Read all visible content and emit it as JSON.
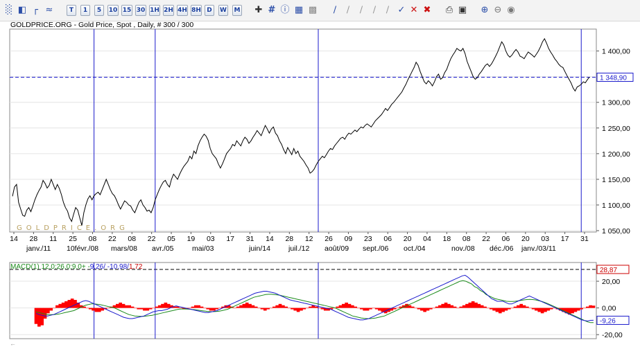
{
  "toolbar": {
    "period_buttons": [
      "T",
      "1",
      "5",
      "10",
      "15",
      "30",
      "1H",
      "2H",
      "4H",
      "8H",
      "D",
      "W",
      "M"
    ]
  },
  "chart_data": [
    {
      "type": "line",
      "title": "GOLDPRICE.ORG - Gold Price, Spot , Daily, # 300 / 300",
      "watermark": "GOLDPRICE.ORG",
      "ylim": [
        1050,
        1440
      ],
      "y_ticks": [
        "1 050,00",
        "1 100,00",
        "1 150,00",
        "1 200,00",
        "1 250,00",
        "1 300,00",
        "1 350,00",
        "1 400,00"
      ],
      "y_tick_values": [
        1050,
        1100,
        1150,
        1200,
        1250,
        1300,
        1350,
        1400
      ],
      "x_day_labels": [
        "14",
        "28",
        "11",
        "25",
        "08",
        "22",
        "08",
        "22",
        "05",
        "19",
        "03",
        "17",
        "31",
        "14",
        "28",
        "12",
        "26",
        "09",
        "23",
        "06",
        "20",
        "04",
        "18",
        "08",
        "22",
        "06",
        "20",
        "03",
        "17",
        "31"
      ],
      "x_month_labels": [
        "janv./11",
        "10févr./08",
        "mars/08",
        "avr./05",
        "mai/03",
        "juin/14",
        "juil./12",
        "août/09",
        "sept./06",
        "oct./04",
        "nov./08",
        "déc./06",
        "janv./03/11"
      ],
      "last_value": 1348.9,
      "last_value_label": "1 348,90",
      "line_color": "#000000",
      "hline_color": "#1a1acc",
      "vline_color": "#1a1acc",
      "series": [
        {
          "values": [
            1117,
            1135,
            1140,
            1105,
            1092,
            1080,
            1078,
            1090,
            1095,
            1087,
            1098,
            1110,
            1120,
            1128,
            1135,
            1148,
            1142,
            1133,
            1138,
            1150,
            1140,
            1130,
            1140,
            1132,
            1120,
            1105,
            1095,
            1088,
            1075,
            1068,
            1082,
            1095,
            1090,
            1075,
            1060,
            1085,
            1100,
            1112,
            1118,
            1110,
            1118,
            1122,
            1125,
            1120,
            1130,
            1140,
            1150,
            1140,
            1130,
            1122,
            1118,
            1110,
            1100,
            1092,
            1100,
            1108,
            1105,
            1100,
            1098,
            1090,
            1085,
            1095,
            1105,
            1110,
            1100,
            1095,
            1088,
            1090,
            1085,
            1095,
            1110,
            1120,
            1130,
            1138,
            1145,
            1148,
            1140,
            1135,
            1150,
            1160,
            1155,
            1150,
            1160,
            1168,
            1175,
            1180,
            1185,
            1195,
            1190,
            1205,
            1200,
            1215,
            1225,
            1232,
            1238,
            1234,
            1226,
            1210,
            1200,
            1195,
            1190,
            1180,
            1172,
            1180,
            1190,
            1200,
            1205,
            1210,
            1218,
            1215,
            1225,
            1220,
            1215,
            1225,
            1232,
            1228,
            1220,
            1225,
            1232,
            1238,
            1245,
            1240,
            1235,
            1245,
            1255,
            1248,
            1240,
            1248,
            1252,
            1240,
            1235,
            1225,
            1218,
            1208,
            1200,
            1212,
            1205,
            1198,
            1210,
            1200,
            1205,
            1195,
            1190,
            1185,
            1178,
            1172,
            1162,
            1165,
            1170,
            1178,
            1185,
            1190,
            1195,
            1192,
            1198,
            1205,
            1210,
            1208,
            1215,
            1220,
            1225,
            1230,
            1232,
            1228,
            1235,
            1240,
            1238,
            1242,
            1246,
            1243,
            1248,
            1252,
            1250,
            1255,
            1258,
            1255,
            1252,
            1258,
            1264,
            1268,
            1272,
            1276,
            1282,
            1288,
            1284,
            1290,
            1296,
            1300,
            1305,
            1310,
            1315,
            1320,
            1328,
            1335,
            1344,
            1352,
            1360,
            1368,
            1378,
            1372,
            1360,
            1350,
            1340,
            1336,
            1342,
            1338,
            1332,
            1340,
            1350,
            1355,
            1345,
            1348,
            1358,
            1364,
            1375,
            1385,
            1392,
            1398,
            1405,
            1402,
            1400,
            1405,
            1395,
            1380,
            1370,
            1360,
            1350,
            1345,
            1348,
            1355,
            1360,
            1366,
            1372,
            1375,
            1370,
            1375,
            1382,
            1390,
            1398,
            1408,
            1418,
            1412,
            1400,
            1392,
            1388,
            1392,
            1398,
            1403,
            1398,
            1390,
            1388,
            1385,
            1392,
            1398,
            1395,
            1392,
            1388,
            1394,
            1400,
            1408,
            1418,
            1424,
            1415,
            1405,
            1398,
            1392,
            1385,
            1380,
            1374,
            1370,
            1368,
            1360,
            1352,
            1345,
            1338,
            1328,
            1322,
            1330,
            1332,
            1335,
            1340,
            1338,
            1344,
            1349
          ]
        }
      ]
    },
    {
      "type": "bar",
      "title": "MACD(1) 12,0;26,0;9,0+ -9,26/ -10,98/ 1,72",
      "legend_text": {
        "prefix": "MACD(1) 12,0;26,0;9,0+ -",
        "macd": "9,26",
        "signal": "/ -10,98/",
        "hist": "1,72"
      },
      "ylim": [
        -22,
        33
      ],
      "y_ticks": [
        "20,00",
        "0,00",
        "-20,00"
      ],
      "y_tick_values": [
        20,
        0,
        -20
      ],
      "flags": [
        {
          "label": "28,87",
          "value": 28.87,
          "color": "#cc0000"
        },
        {
          "label": "-9,26",
          "value": -9.26,
          "color": "#1a1acc"
        }
      ],
      "colors": {
        "macd": "#1a1acc",
        "signal": "#1a8a1a",
        "hist": "#ff0000"
      },
      "macd_series": [
        -4,
        -5,
        -5.5,
        -6,
        -6,
        -5.5,
        -5,
        -4,
        -3,
        -2,
        -1,
        0,
        1,
        2,
        3,
        4,
        5,
        5.5,
        5,
        4,
        3,
        2,
        1,
        0,
        -1,
        -2,
        -3,
        -4,
        -5,
        -6,
        -7,
        -7.5,
        -8,
        -8,
        -7.5,
        -7,
        -6.5,
        -6,
        -5,
        -4,
        -3,
        -2.5,
        -2,
        -2,
        -1.5,
        -1,
        0,
        1,
        1.5,
        1,
        0.5,
        0,
        -0.5,
        -1,
        -1.5,
        -2,
        -2.5,
        -3,
        -3.5,
        -3.5,
        -3,
        -2.5,
        -2,
        -1,
        0,
        1,
        2,
        3,
        4,
        5,
        6,
        7,
        8,
        9,
        10,
        11,
        11.5,
        12,
        12.5,
        12.5,
        12,
        11.5,
        11,
        10,
        9,
        8,
        7,
        6,
        5.5,
        5,
        4.5,
        4,
        3.5,
        3,
        2.5,
        2,
        1.5,
        1,
        0.5,
        0,
        -0.5,
        -1,
        -2,
        -3,
        -4,
        -5,
        -6,
        -7,
        -7.5,
        -8,
        -8.5,
        -9,
        -9,
        -8.5,
        -8,
        -7,
        -6,
        -5,
        -4,
        -3,
        -2,
        -1,
        0,
        1,
        2,
        3,
        4,
        5,
        6,
        7,
        8,
        9,
        10,
        11,
        12,
        13,
        14,
        15,
        16,
        17,
        18,
        19,
        20,
        21,
        22,
        23,
        24,
        24.5,
        23,
        21,
        19,
        17,
        15,
        13,
        11,
        9,
        7,
        6,
        5,
        5,
        5,
        4,
        3,
        3,
        4,
        5,
        6,
        7,
        8,
        9,
        8,
        7,
        6,
        5,
        4,
        3,
        2,
        1,
        0,
        -1,
        -2,
        -3,
        -4,
        -5,
        -6,
        -7,
        -8,
        -9,
        -9.5,
        -9.8,
        -9.3,
        -9.26
      ],
      "signal_series": [
        -3,
        -3.5,
        -4,
        -4.5,
        -5,
        -5,
        -5,
        -4.8,
        -4.5,
        -4,
        -3.5,
        -3,
        -2.5,
        -2,
        -1,
        0,
        1,
        2,
        2.5,
        3,
        3,
        2.8,
        2.5,
        2,
        1.5,
        1,
        0.5,
        0,
        -1,
        -2,
        -3,
        -4,
        -5,
        -5.5,
        -6,
        -6.2,
        -6.3,
        -6.3,
        -6,
        -5.8,
        -5.5,
        -5,
        -4.5,
        -4,
        -3.5,
        -3,
        -2.5,
        -2,
        -1.5,
        -1,
        -0.8,
        -0.8,
        -0.9,
        -1,
        -1.2,
        -1.4,
        -1.7,
        -2,
        -2.3,
        -2.6,
        -2.8,
        -2.8,
        -2.7,
        -2.5,
        -2,
        -1.5,
        -1,
        0,
        1,
        2,
        3,
        4,
        5,
        6,
        7,
        8,
        8.5,
        9,
        9.5,
        10,
        10.2,
        10.2,
        10,
        9.8,
        9.5,
        9,
        8.5,
        8,
        7.5,
        7,
        6.5,
        6,
        5.5,
        5,
        4.5,
        4,
        3.5,
        3,
        2.5,
        2,
        1.5,
        1,
        0.5,
        0,
        -1,
        -2,
        -3,
        -4,
        -5,
        -6,
        -6.5,
        -7,
        -7.5,
        -7.8,
        -8,
        -8,
        -7.8,
        -7.5,
        -7,
        -6.5,
        -6,
        -5,
        -4,
        -3,
        -2,
        -1,
        0,
        1,
        2,
        3,
        4,
        5,
        6,
        7,
        8,
        9,
        10,
        11,
        12,
        13,
        14,
        15,
        16,
        17,
        18,
        19,
        20,
        20.5,
        20,
        19,
        18,
        16,
        15,
        13,
        12,
        10,
        9,
        8,
        7,
        6.5,
        6,
        5.5,
        5,
        4.8,
        4.8,
        5,
        5.3,
        5.6,
        6,
        6.3,
        6.4,
        6.3,
        6,
        5.5,
        5,
        4.3,
        3.5,
        2.5,
        1.5,
        0.5,
        -0.5,
        -1.5,
        -2.5,
        -3.5,
        -4.5,
        -5.5,
        -6.5,
        -7.5,
        -8.5,
        -9.5,
        -10.5,
        -11,
        -10.98
      ],
      "hist_values": [
        -12,
        -14,
        -13,
        -8,
        -4,
        -2,
        0,
        2,
        3,
        4,
        5,
        6,
        7,
        6,
        4,
        2,
        1,
        0,
        -1,
        -2,
        -3,
        -3,
        -2,
        -1,
        0,
        1,
        2,
        3,
        4,
        3,
        2,
        2,
        1,
        0,
        -1,
        -1,
        -2,
        -2,
        -1,
        0,
        1,
        2,
        3,
        4,
        3,
        2,
        1,
        1,
        0,
        -1,
        -1,
        0,
        1,
        2,
        2,
        1,
        0,
        -1,
        -2,
        -2,
        -1,
        0,
        1,
        2,
        2,
        1,
        0,
        1,
        2,
        3,
        4,
        3,
        2,
        1,
        0,
        -1,
        -2,
        -1,
        0,
        1,
        2,
        3,
        2,
        1,
        0,
        -1,
        -2,
        -3,
        -2,
        -1,
        0,
        1,
        2,
        1,
        0,
        -1,
        -2,
        -2,
        -1,
        0,
        1,
        2,
        3,
        4,
        3,
        2,
        1,
        0,
        -1,
        -2,
        -2,
        -1,
        0,
        -1,
        -2,
        -3,
        -4,
        -3,
        -2,
        -1,
        0,
        1,
        2,
        3,
        2,
        1,
        0,
        -1,
        -2,
        -3,
        -2,
        -1,
        0,
        1,
        2,
        3,
        4,
        3,
        2,
        1,
        0,
        1,
        2,
        3,
        4,
        5,
        4,
        3,
        2,
        1,
        0,
        -1,
        -2,
        -3,
        -4,
        -3,
        -2,
        -1,
        0,
        1,
        2,
        3,
        2,
        1,
        0,
        -1,
        -2,
        -3,
        -4,
        -3,
        -2,
        -1,
        0,
        -1,
        -2,
        -3,
        -4,
        -5,
        -4,
        -3,
        -2,
        -1,
        0,
        1,
        2,
        1.72
      ]
    }
  ]
}
